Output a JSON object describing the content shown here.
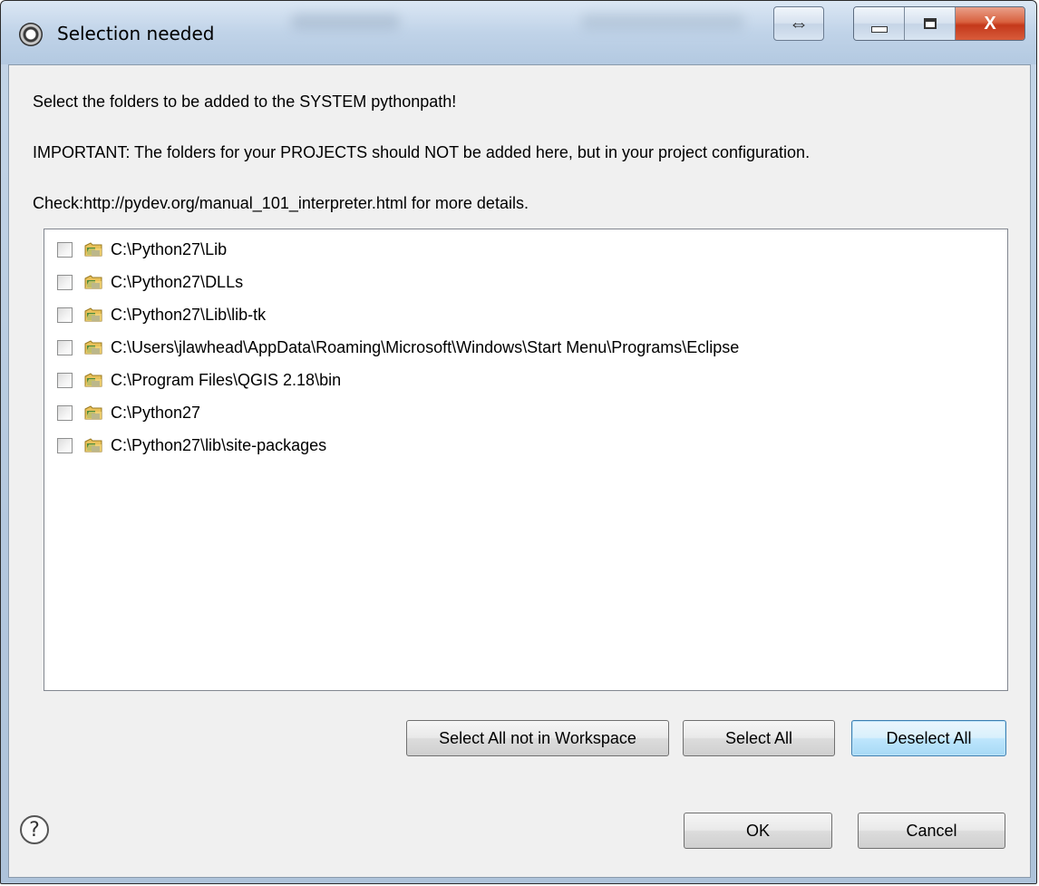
{
  "window": {
    "title": "Selection needed",
    "controls": {
      "swap_glyph": "⇔",
      "close_glyph": "X"
    }
  },
  "messages": {
    "line1": "Select the folders to be added to the SYSTEM pythonpath!",
    "line2": "IMPORTANT: The folders for your PROJECTS should NOT be added here, but in your project configuration.",
    "line3": "Check:http://pydev.org/manual_101_interpreter.html for more details."
  },
  "folders": [
    {
      "path": "C:\\Python27\\Lib",
      "checked": false
    },
    {
      "path": "C:\\Python27\\DLLs",
      "checked": false
    },
    {
      "path": "C:\\Python27\\Lib\\lib-tk",
      "checked": false
    },
    {
      "path": "C:\\Users\\jlawhead\\AppData\\Roaming\\Microsoft\\Windows\\Start Menu\\Programs\\Eclipse",
      "checked": false
    },
    {
      "path": "C:\\Program Files\\QGIS 2.18\\bin",
      "checked": false
    },
    {
      "path": "C:\\Python27",
      "checked": false
    },
    {
      "path": "C:\\Python27\\lib\\site-packages",
      "checked": false
    }
  ],
  "selection_buttons": {
    "select_not_in_workspace": "Select All not in Workspace",
    "select_all": "Select All",
    "deselect_all": "Deselect All"
  },
  "dialog_buttons": {
    "ok": "OK",
    "cancel": "Cancel",
    "help_glyph": "?"
  },
  "icons": {
    "app": "eclipse-gear-icon",
    "folder": "python-folder-icon",
    "help": "help-icon"
  },
  "colors": {
    "titlebar": "#c0d3e8",
    "close": "#c4381a",
    "default_button_border": "#3c7fb1",
    "client_bg": "#f0f0f0"
  }
}
